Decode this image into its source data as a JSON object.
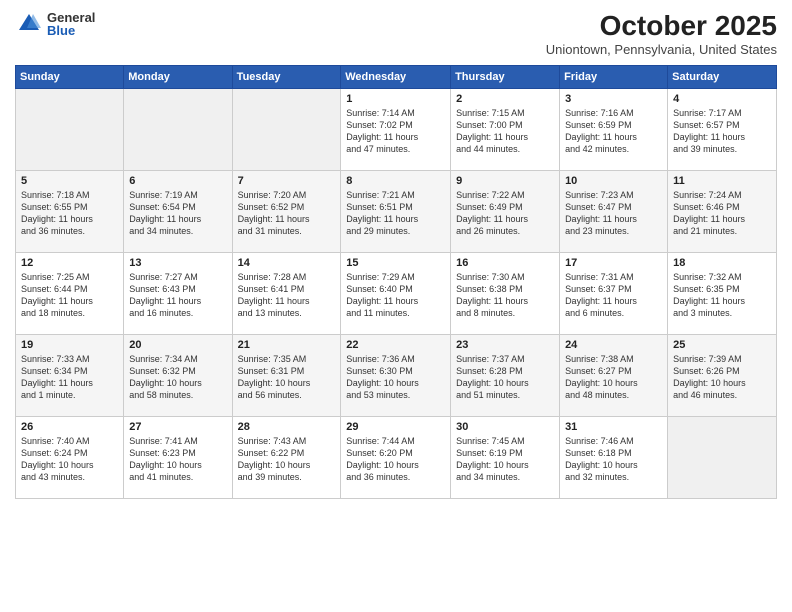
{
  "logo": {
    "general": "General",
    "blue": "Blue"
  },
  "title": "October 2025",
  "location": "Uniontown, Pennsylvania, United States",
  "days_of_week": [
    "Sunday",
    "Monday",
    "Tuesday",
    "Wednesday",
    "Thursday",
    "Friday",
    "Saturday"
  ],
  "weeks": [
    [
      {
        "day": "",
        "info": ""
      },
      {
        "day": "",
        "info": ""
      },
      {
        "day": "",
        "info": ""
      },
      {
        "day": "1",
        "info": "Sunrise: 7:14 AM\nSunset: 7:02 PM\nDaylight: 11 hours\nand 47 minutes."
      },
      {
        "day": "2",
        "info": "Sunrise: 7:15 AM\nSunset: 7:00 PM\nDaylight: 11 hours\nand 44 minutes."
      },
      {
        "day": "3",
        "info": "Sunrise: 7:16 AM\nSunset: 6:59 PM\nDaylight: 11 hours\nand 42 minutes."
      },
      {
        "day": "4",
        "info": "Sunrise: 7:17 AM\nSunset: 6:57 PM\nDaylight: 11 hours\nand 39 minutes."
      }
    ],
    [
      {
        "day": "5",
        "info": "Sunrise: 7:18 AM\nSunset: 6:55 PM\nDaylight: 11 hours\nand 36 minutes."
      },
      {
        "day": "6",
        "info": "Sunrise: 7:19 AM\nSunset: 6:54 PM\nDaylight: 11 hours\nand 34 minutes."
      },
      {
        "day": "7",
        "info": "Sunrise: 7:20 AM\nSunset: 6:52 PM\nDaylight: 11 hours\nand 31 minutes."
      },
      {
        "day": "8",
        "info": "Sunrise: 7:21 AM\nSunset: 6:51 PM\nDaylight: 11 hours\nand 29 minutes."
      },
      {
        "day": "9",
        "info": "Sunrise: 7:22 AM\nSunset: 6:49 PM\nDaylight: 11 hours\nand 26 minutes."
      },
      {
        "day": "10",
        "info": "Sunrise: 7:23 AM\nSunset: 6:47 PM\nDaylight: 11 hours\nand 23 minutes."
      },
      {
        "day": "11",
        "info": "Sunrise: 7:24 AM\nSunset: 6:46 PM\nDaylight: 11 hours\nand 21 minutes."
      }
    ],
    [
      {
        "day": "12",
        "info": "Sunrise: 7:25 AM\nSunset: 6:44 PM\nDaylight: 11 hours\nand 18 minutes."
      },
      {
        "day": "13",
        "info": "Sunrise: 7:27 AM\nSunset: 6:43 PM\nDaylight: 11 hours\nand 16 minutes."
      },
      {
        "day": "14",
        "info": "Sunrise: 7:28 AM\nSunset: 6:41 PM\nDaylight: 11 hours\nand 13 minutes."
      },
      {
        "day": "15",
        "info": "Sunrise: 7:29 AM\nSunset: 6:40 PM\nDaylight: 11 hours\nand 11 minutes."
      },
      {
        "day": "16",
        "info": "Sunrise: 7:30 AM\nSunset: 6:38 PM\nDaylight: 11 hours\nand 8 minutes."
      },
      {
        "day": "17",
        "info": "Sunrise: 7:31 AM\nSunset: 6:37 PM\nDaylight: 11 hours\nand 6 minutes."
      },
      {
        "day": "18",
        "info": "Sunrise: 7:32 AM\nSunset: 6:35 PM\nDaylight: 11 hours\nand 3 minutes."
      }
    ],
    [
      {
        "day": "19",
        "info": "Sunrise: 7:33 AM\nSunset: 6:34 PM\nDaylight: 11 hours\nand 1 minute."
      },
      {
        "day": "20",
        "info": "Sunrise: 7:34 AM\nSunset: 6:32 PM\nDaylight: 10 hours\nand 58 minutes."
      },
      {
        "day": "21",
        "info": "Sunrise: 7:35 AM\nSunset: 6:31 PM\nDaylight: 10 hours\nand 56 minutes."
      },
      {
        "day": "22",
        "info": "Sunrise: 7:36 AM\nSunset: 6:30 PM\nDaylight: 10 hours\nand 53 minutes."
      },
      {
        "day": "23",
        "info": "Sunrise: 7:37 AM\nSunset: 6:28 PM\nDaylight: 10 hours\nand 51 minutes."
      },
      {
        "day": "24",
        "info": "Sunrise: 7:38 AM\nSunset: 6:27 PM\nDaylight: 10 hours\nand 48 minutes."
      },
      {
        "day": "25",
        "info": "Sunrise: 7:39 AM\nSunset: 6:26 PM\nDaylight: 10 hours\nand 46 minutes."
      }
    ],
    [
      {
        "day": "26",
        "info": "Sunrise: 7:40 AM\nSunset: 6:24 PM\nDaylight: 10 hours\nand 43 minutes."
      },
      {
        "day": "27",
        "info": "Sunrise: 7:41 AM\nSunset: 6:23 PM\nDaylight: 10 hours\nand 41 minutes."
      },
      {
        "day": "28",
        "info": "Sunrise: 7:43 AM\nSunset: 6:22 PM\nDaylight: 10 hours\nand 39 minutes."
      },
      {
        "day": "29",
        "info": "Sunrise: 7:44 AM\nSunset: 6:20 PM\nDaylight: 10 hours\nand 36 minutes."
      },
      {
        "day": "30",
        "info": "Sunrise: 7:45 AM\nSunset: 6:19 PM\nDaylight: 10 hours\nand 34 minutes."
      },
      {
        "day": "31",
        "info": "Sunrise: 7:46 AM\nSunset: 6:18 PM\nDaylight: 10 hours\nand 32 minutes."
      },
      {
        "day": "",
        "info": ""
      }
    ]
  ]
}
